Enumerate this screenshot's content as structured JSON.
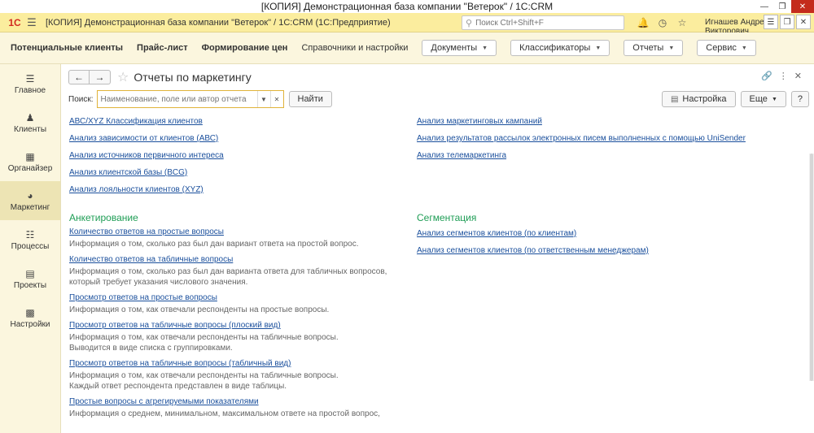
{
  "window": {
    "title": "[КОПИЯ] Демонстрационная база компании \"Ветерок\" / 1С:CRM"
  },
  "appbar": {
    "logo": "1С",
    "title": "[КОПИЯ] Демонстрационная база компании \"Ветерок\" / 1С:CRM  (1С:Предприятие)",
    "search_placeholder": "Поиск Ctrl+Shift+F",
    "user": "Игнашев Андрей Викторович"
  },
  "sections": {
    "items": [
      "Потенциальные клиенты",
      "Прайс-лист",
      "Формирование цен"
    ],
    "plain_item": "Справочники и настройки",
    "dropdowns": [
      "Документы",
      "Классификаторы",
      "Отчеты",
      "Сервис"
    ]
  },
  "sidebar": {
    "items": [
      {
        "label": "Главное",
        "icon": "menu-icon"
      },
      {
        "label": "Клиенты",
        "icon": "people-icon"
      },
      {
        "label": "Органайзер",
        "icon": "calendar-icon"
      },
      {
        "label": "Маркетинг",
        "icon": "pie-icon"
      },
      {
        "label": "Процессы",
        "icon": "process-icon"
      },
      {
        "label": "Проекты",
        "icon": "chart-icon"
      },
      {
        "label": "Настройки",
        "icon": "settings-icon"
      }
    ]
  },
  "main": {
    "title": "Отчеты по маркетингу",
    "search_label": "Поиск:",
    "search_placeholder": "Наименование, поле или автор отчета",
    "find_button": "Найти",
    "settings_button": "Настройка",
    "more_button": "Еще",
    "help_button": "?",
    "left_links": [
      "АВС/XYZ  Классификация клиентов",
      "Анализ зависимости от клиентов (АВС)",
      "Анализ источников первичного интереса",
      "Анализ клиентской базы (BCG)",
      "Анализ лояльности клиентов (XYZ)"
    ],
    "right_links": [
      "Анализ маркетинговых кампаний",
      "Анализ результатов рассылок электронных писем выполненных с помощью UniSender",
      "Анализ телемаркетинга"
    ],
    "survey": {
      "title": "Анкетирование",
      "items": [
        {
          "link": "Количество ответов на простые вопросы",
          "desc": [
            "Информация о том, сколько раз был дан вариант ответа на простой вопрос."
          ]
        },
        {
          "link": "Количество ответов на табличные вопросы",
          "desc": [
            "Информация о том, сколько раз был дан варианта ответа для табличных вопросов,",
            "который требует указания числового значения."
          ]
        },
        {
          "link": "Просмотр ответов на простые вопросы",
          "desc": [
            "Информация о том, как отвечали респонденты на простые вопросы."
          ]
        },
        {
          "link": "Просмотр ответов на табличные вопросы (плоский вид)",
          "desc": [
            "Информация о том, как отвечали респонденты на табличные вопросы.",
            "Выводится в виде списка с группировками."
          ]
        },
        {
          "link": "Просмотр ответов на табличные вопросы (табличный вид)",
          "desc": [
            "Информация о том, как  отвечали респонденты на табличные вопросы.",
            "Каждый ответ респондента представлен в виде таблицы."
          ]
        },
        {
          "link": "Простые вопросы с агрегируемыми показателями",
          "desc": [
            "Информация о среднем, минимальном, максимальном ответе на простой вопрос,"
          ]
        }
      ]
    },
    "segmentation": {
      "title": "Сегментация",
      "links": [
        "Анализ сегментов клиентов (по клиентам)",
        "Анализ сегментов клиентов (по ответственным менеджерам)"
      ]
    }
  }
}
